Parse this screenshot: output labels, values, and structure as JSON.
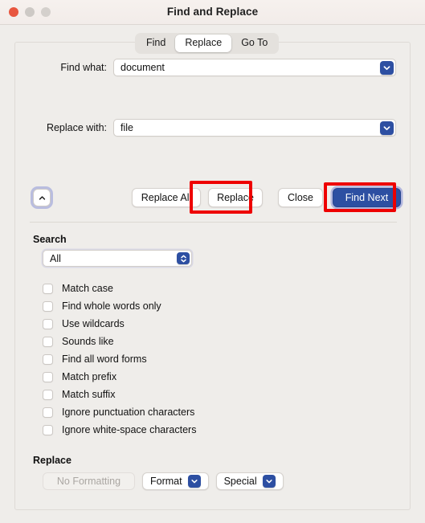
{
  "window": {
    "title": "Find and Replace",
    "traffic_lights": [
      "close",
      "minimize",
      "zoom"
    ]
  },
  "tabs": [
    {
      "label": "Find",
      "active": false
    },
    {
      "label": "Replace",
      "active": true
    },
    {
      "label": "Go To",
      "active": false
    }
  ],
  "fields": {
    "find": {
      "label": "Find what:",
      "value": "document",
      "placeholder": ""
    },
    "replace": {
      "label": "Replace with:",
      "value": "file",
      "placeholder": ""
    }
  },
  "actions": {
    "collapse_label": "",
    "replace_all": "Replace All",
    "replace": "Replace",
    "close": "Close",
    "find_next": "Find Next"
  },
  "search": {
    "title": "Search",
    "selected": "All",
    "options": [
      {
        "label": "Match case",
        "checked": false
      },
      {
        "label": "Find whole words only",
        "checked": false
      },
      {
        "label": "Use wildcards",
        "checked": false
      },
      {
        "label": "Sounds like",
        "checked": false
      },
      {
        "label": "Find all word forms",
        "checked": false
      },
      {
        "label": "Match prefix",
        "checked": false
      },
      {
        "label": "Match suffix",
        "checked": false
      },
      {
        "label": "Ignore punctuation characters",
        "checked": false
      },
      {
        "label": "Ignore white-space characters",
        "checked": false
      }
    ]
  },
  "replace_section": {
    "title": "Replace",
    "no_formatting": "No Formatting",
    "format": "Format",
    "special": "Special"
  },
  "colors": {
    "accent_blue": "#2d4fa2",
    "highlight_red": "#ee0000",
    "window_bg": "#efedea",
    "titlebar_bg": "#f4efec",
    "close_light": "#e8563f"
  },
  "annotations": [
    {
      "target": "Replace",
      "color": "#ee0000"
    },
    {
      "target": "Find Next",
      "color": "#ee0000"
    }
  ]
}
